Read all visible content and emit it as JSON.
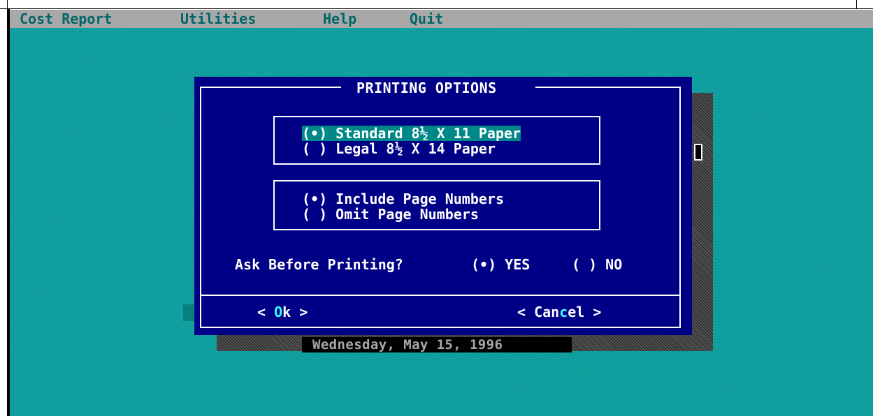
{
  "menu": {
    "items": [
      "Cost Report",
      "Utilities",
      "Help",
      "Quit"
    ]
  },
  "dialog": {
    "title": "PRINTING OPTIONS",
    "paper_group": {
      "options": [
        {
          "label": "(•) Standard 8½ X 11 Paper",
          "selected": true
        },
        {
          "label": "( ) Legal 8½ X 14 Paper",
          "selected": false
        }
      ]
    },
    "page_number_group": {
      "options": [
        {
          "label": "(•) Include Page Numbers",
          "selected": true
        },
        {
          "label": "( ) Omit Page Numbers",
          "selected": false
        }
      ]
    },
    "ask_before_printing": {
      "label": "Ask Before Printing?",
      "yes": "(•) YES",
      "no": "( ) NO",
      "value": "YES"
    },
    "buttons": {
      "ok_prefix": "< ",
      "ok_hot": "O",
      "ok_rest": "k >",
      "cancel_prefix": "< Can",
      "cancel_hot": "c",
      "cancel_rest": "el >"
    }
  },
  "status": {
    "date": "Wednesday, May 15, 1996"
  },
  "colors": {
    "desktop": "#0c9a9a",
    "dialog_bg": "#000086",
    "menubar_bg": "#a8a8a8",
    "menu_text": "#006666",
    "selection_bg": "#008888",
    "hotkey": "#33ffff"
  }
}
